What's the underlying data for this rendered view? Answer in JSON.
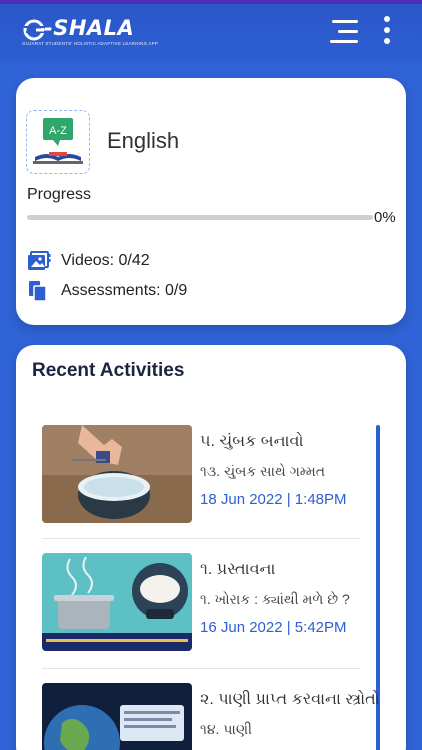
{
  "app": {
    "logo_text": "-SHALA",
    "logo_tagline": "GUJARAT STUDENTS' HOLISTIC ADAPTIVE LEARNING APP",
    "menu_icon": "hamburger-menu-icon",
    "more_icon": "more-vertical-icon"
  },
  "subject": {
    "icon_label": "A-Z",
    "name": "English",
    "progress_label": "Progress",
    "progress_value": 0,
    "progress_text": "0%",
    "videos_text": "Videos: 0/42",
    "assessments_text": "Assessments: 0/9"
  },
  "recent": {
    "title": "Recent Activities",
    "items": [
      {
        "title": "૫. ચુંબક બનાવો",
        "subtitle": "૧૩. ચુંબક સાથે ગમ્મત",
        "date": "18 Jun 2022 | 1:48PM"
      },
      {
        "title": "૧. પ્રસ્તાવના",
        "subtitle": "૧. ખોરાક : ક્યાંથી મળે છે ?",
        "date": "16 Jun 2022 | 5:42PM"
      },
      {
        "title": "૨. પાણી પ્રાપ્ત કરવાના સ્ત્રોતો",
        "subtitle": "૧૪. પાણી",
        "date": ""
      }
    ]
  },
  "colors": {
    "brand_blue": "#2d5fd2",
    "card_bg": "#ffffff"
  }
}
